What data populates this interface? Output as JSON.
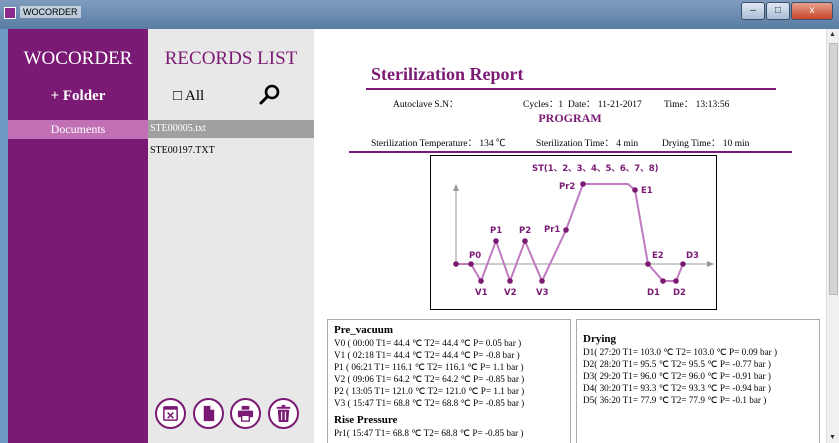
{
  "window": {
    "title": "WOCORDER",
    "min_glyph": "–",
    "max_glyph": "□",
    "close_glyph": "x"
  },
  "sidebar": {
    "brand": "WOCORDER",
    "add_folder": "+ Folder",
    "items": [
      {
        "label": "Documents"
      }
    ]
  },
  "records": {
    "title": "RECORDS LIST",
    "all_label": "□ All",
    "files": [
      {
        "name": "STE00005.txt"
      },
      {
        "name": "STE00197.TXT"
      }
    ]
  },
  "report": {
    "title": "Sterilization Report",
    "autoclave": "Autoclave S.N：",
    "cycles": "Cycles：1",
    "date": "Date： 11-21-2017",
    "time": "Time： 13:13:56",
    "program_heading": "PROGRAM",
    "ster_temp": "Sterilization Temperature： 134 ℃",
    "ster_time": "Sterilization Time： 4 min",
    "drying_time": "Drying Time： 10 min"
  },
  "diagram": {
    "st_label": "ST(1、2、3、4、5、6、7、8)",
    "labels": {
      "P0": "P0",
      "V1": "V1",
      "P1": "P1",
      "V2": "V2",
      "P2": "P2",
      "V3": "V3",
      "Pr1": "Pr1",
      "Pr2": "Pr2",
      "E1": "E1",
      "E2": "E2",
      "D1": "D1",
      "D2": "D2",
      "D3": "D3"
    },
    "accent": "#c07ac0",
    "point_color": "#7b1a74"
  },
  "pre_vacuum": {
    "title": "Pre_vacuum",
    "rows": [
      "V0 ( 00:00 T1= 44.4 ℃ T2= 44.4 ℃ P= 0.05 bar )",
      "V1 ( 02:18 T1= 44.4 ℃ T2= 44.4 ℃ P= -0.8 bar )",
      "P1 ( 06:21 T1= 116.1 ℃ T2= 116.1 ℃ P= 1.1 bar )",
      "V2 ( 09:06 T1= 64.2 ℃ T2= 64.2 ℃ P= -0.85 bar )",
      "P2 ( 13:05 T1= 121.0 ℃ T2= 121.0 ℃ P= 1.1 bar )",
      "V3 ( 15:47 T1= 68.8 ℃ T2= 68.8 ℃ P= -0.85 bar )"
    ]
  },
  "rise_pressure": {
    "title": "Rise Pressure",
    "rows": [
      "Pr1( 15:47 T1= 68.8 ℃ T2= 68.8 ℃ P= -0.85 bar )"
    ]
  },
  "drying": {
    "title": "Drying",
    "rows": [
      "D1( 27:20 T1= 103.0 ℃ T2= 103.0 ℃ P= 0.09 bar )",
      "D2( 28:20 T1= 95.5 ℃ T2= 95.5 ℃ P= -0.77 bar )",
      "D3( 29:20 T1= 96.0 ℃ T2= 96.0 ℃ P= -0.91 bar )",
      "D4( 30:20 T1= 93.3 ℃ T2= 93.3 ℃ P= -0.94 bar )",
      "D5( 36:20 T1= 77.9 ℃ T2= 77.9 ℃ P= -0.1 bar )"
    ]
  },
  "actions": [
    "close-file-icon",
    "document-icon",
    "print-icon",
    "trash-icon"
  ],
  "colors": {
    "brand": "#7b1a74",
    "selected": "#c170b6"
  }
}
